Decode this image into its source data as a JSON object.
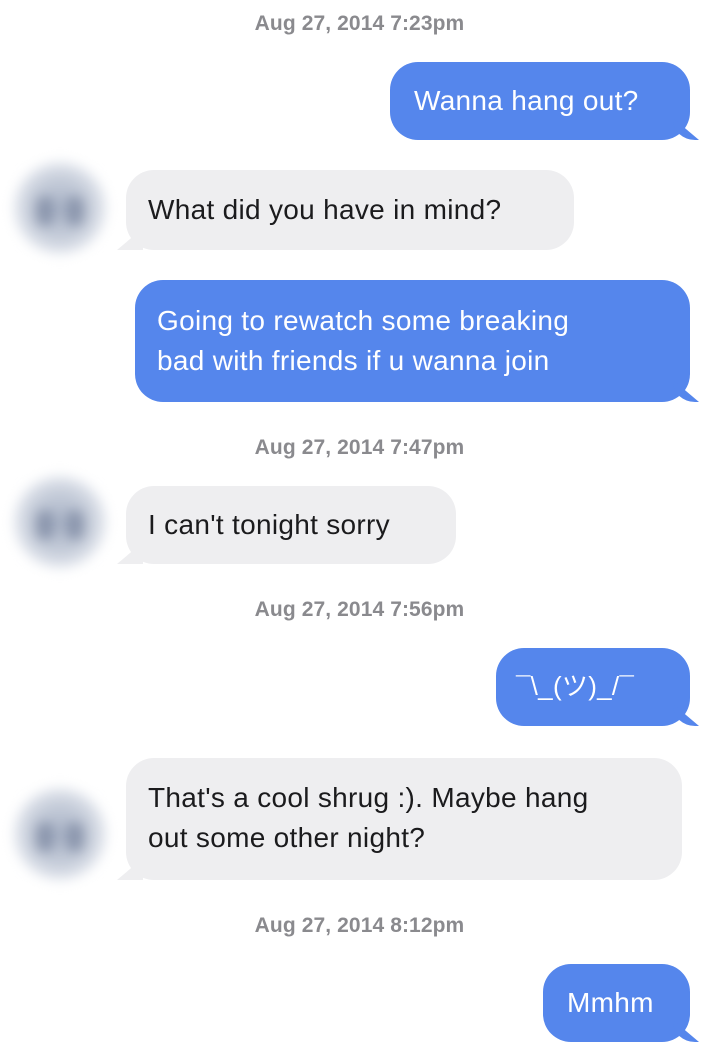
{
  "conversation": {
    "timestamps": [
      "Aug 27, 2014 7:23pm",
      "Aug 27, 2014 7:47pm",
      "Aug 27, 2014 7:56pm",
      "Aug 27, 2014 8:12pm"
    ],
    "messages": [
      {
        "from": "me",
        "text": "Wanna hang out?"
      },
      {
        "from": "them",
        "text": "What did you have in mind?"
      },
      {
        "from": "me",
        "lines": [
          "Going to rewatch some breaking",
          "bad with friends if u wanna join"
        ]
      },
      {
        "from": "them",
        "text": "I can't tonight sorry"
      },
      {
        "from": "me",
        "text": "¯\\_(ツ)_/¯"
      },
      {
        "from": "them",
        "lines": [
          "That's a cool shrug :). Maybe hang",
          "out some other night?"
        ]
      },
      {
        "from": "me",
        "text": "Mmhm"
      }
    ]
  },
  "colors": {
    "sent_bubble": "#5586ec",
    "received_bubble": "#eeeef0",
    "timestamp_text": "#8a8a8e"
  }
}
